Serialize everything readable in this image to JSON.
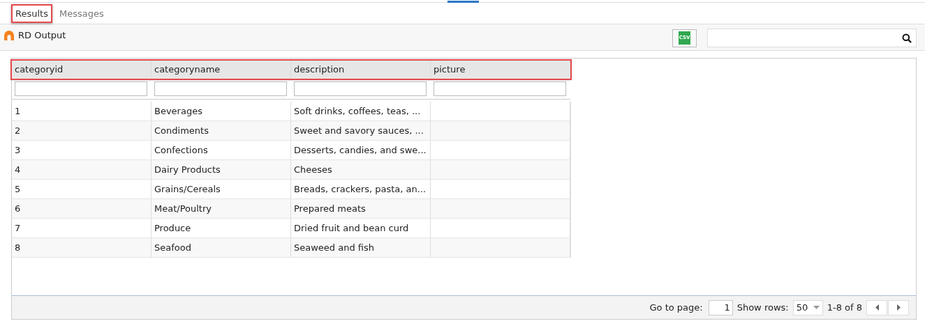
{
  "tabs": [
    {
      "label": "Results",
      "selected": true,
      "highlighted": true
    },
    {
      "label": "Messages",
      "selected": false,
      "highlighted": false
    }
  ],
  "toolbar": {
    "title": "RD Output",
    "csv_button": "CSV"
  },
  "table": {
    "header_highlighted": true,
    "columns": [
      "categoryid",
      "categoryname",
      "description",
      "picture"
    ],
    "rows": [
      [
        "1",
        "Beverages",
        "Soft drinks, coffees, teas, ...",
        ""
      ],
      [
        "2",
        "Condiments",
        "Sweet and savory sauces, ...",
        ""
      ],
      [
        "3",
        "Confections",
        "Desserts, candies, and swe...",
        ""
      ],
      [
        "4",
        "Dairy Products",
        "Cheeses",
        ""
      ],
      [
        "5",
        "Grains/Cereals",
        "Breads, crackers, pasta, an...",
        ""
      ],
      [
        "6",
        "Meat/Poultry",
        "Prepared meats",
        ""
      ],
      [
        "7",
        "Produce",
        "Dried fruit and bean curd",
        ""
      ],
      [
        "8",
        "Seafood",
        "Seaweed and fish",
        ""
      ]
    ]
  },
  "pager": {
    "goto_label": "Go to page:",
    "page": "1",
    "rows_label": "Show rows:",
    "rows_value": "50",
    "range": "1-8 of 8"
  }
}
